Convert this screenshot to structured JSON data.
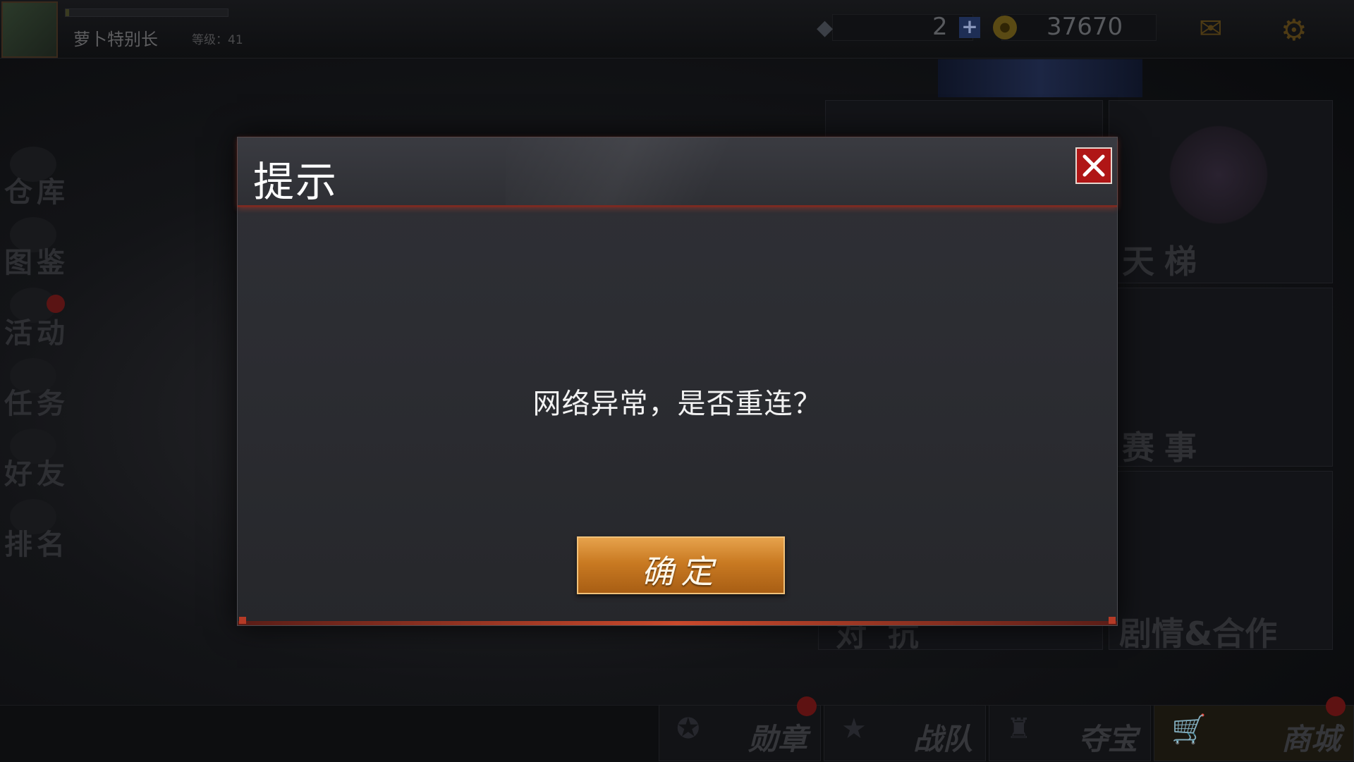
{
  "player": {
    "name": "萝卜特别长",
    "level": "等级：41",
    "xp_fraction": 0.02
  },
  "resources": {
    "diamonds": "2",
    "gold": "37670"
  },
  "side_menu": [
    {
      "label": "仓库"
    },
    {
      "label": "图鉴"
    },
    {
      "label": "活动"
    },
    {
      "label": "任务"
    },
    {
      "label": "好友"
    },
    {
      "label": "排名"
    }
  ],
  "tiles": {
    "ladder": "天梯",
    "events": "赛事",
    "story": "剧情&合作",
    "versus": "对抗"
  },
  "bottom_bar": [
    {
      "label": "勋章"
    },
    {
      "label": "战队"
    },
    {
      "label": "夺宝"
    },
    {
      "label": "商城"
    }
  ],
  "dialog": {
    "title": "提示",
    "message": "网络异常，是否重连？",
    "confirm_label": "确定"
  },
  "colors": {
    "close_red": "#b01616",
    "confirm_gold": "#c97a22",
    "header_accent": "#c9492c"
  }
}
